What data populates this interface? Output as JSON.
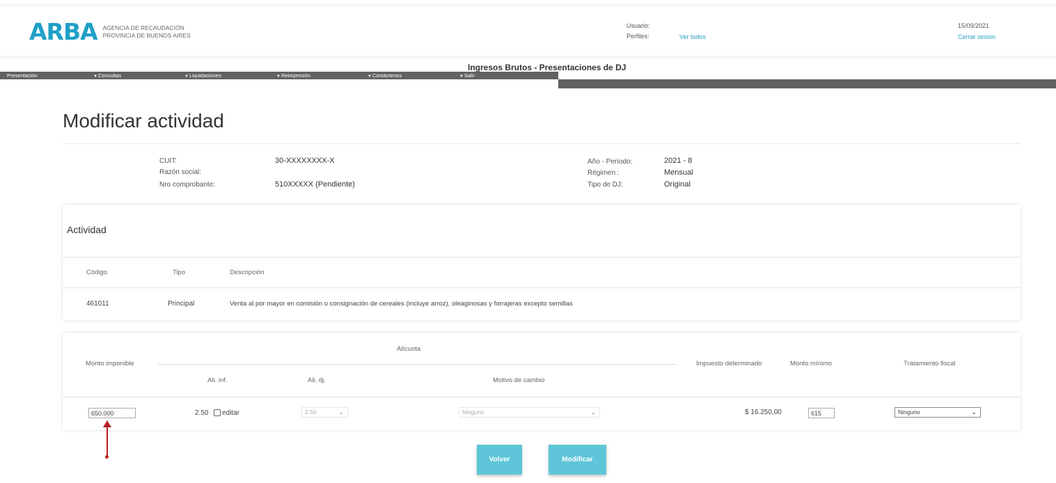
{
  "brand": {
    "mark": "ARBA",
    "line1": "AGENCIA DE RECAUDACIÓN",
    "line2": "PROVINCIA DE BUENOS AIRES",
    "color": "#1fa0c7"
  },
  "user": {
    "usuario_label": "Usuario:",
    "perfiles_label": "Perfiles:",
    "ver_todos": "Ver todos",
    "date": "15/09/2021",
    "logout": "Cerrar sesión"
  },
  "system_title": "Ingresos Brutos - Presentaciones de DJ",
  "menu": [
    "Presentación",
    "Consultas",
    "Liquidaciones",
    "Reimpresión",
    "Contáctenos",
    "Salir"
  ],
  "page_title": "Modificar actividad",
  "info": {
    "cuit_label": "CUIT:",
    "cuit_value": "30-XXXXXXXX-X",
    "razon_label": "Razón social:",
    "razon_value": "",
    "nro_label": "Nro comprobante:",
    "nro_value": "510XXXXX (Pendiente)",
    "anio_label": "Año - Período:",
    "anio_value": "2021 - 8",
    "regimen_label": "Régimen :",
    "regimen_value": "Mensual",
    "tipo_label": "Tipo de DJ:",
    "tipo_value": "Original"
  },
  "actividad": {
    "title": "Actividad",
    "headers": {
      "codigo": "Código",
      "tipo": "Tipo",
      "descripcion": "Descripción"
    },
    "row": {
      "codigo": "461011",
      "tipo": "Principal",
      "descripcion": "Venta al por mayor en comisión o consignación de cereales (incluye arroz), oleaginosas y forrajeras excepto semillas"
    }
  },
  "alicuota": {
    "group_label": "Alícuota",
    "monto_imponible_label": "Monto imponible",
    "ali_inf_label": "Ali. inf.",
    "ali_dj_label": "Ali. dj.",
    "motivo_label": "Motivo de cambio",
    "impuesto_label": "Impuesto determinado",
    "monto_minimo_label": "Monto mínimo",
    "tratamiento_label": "Tratamiento fiscal",
    "row": {
      "monto_imponible": "650.000",
      "ali_inf": "2.50",
      "editar_label": "editar",
      "ali_dj": "2.50",
      "motivo": "Ninguno",
      "impuesto": "$ 16.250,00",
      "monto_minimo": "615",
      "tratamiento": "Ninguno"
    }
  },
  "buttons": {
    "volver": "Volver",
    "modificar": "Modificar"
  },
  "colors": {
    "button": "#5ec6d8",
    "menubar": "#626262",
    "annotation_arrow": "#b81f1f",
    "link": "#2a9fc4"
  }
}
